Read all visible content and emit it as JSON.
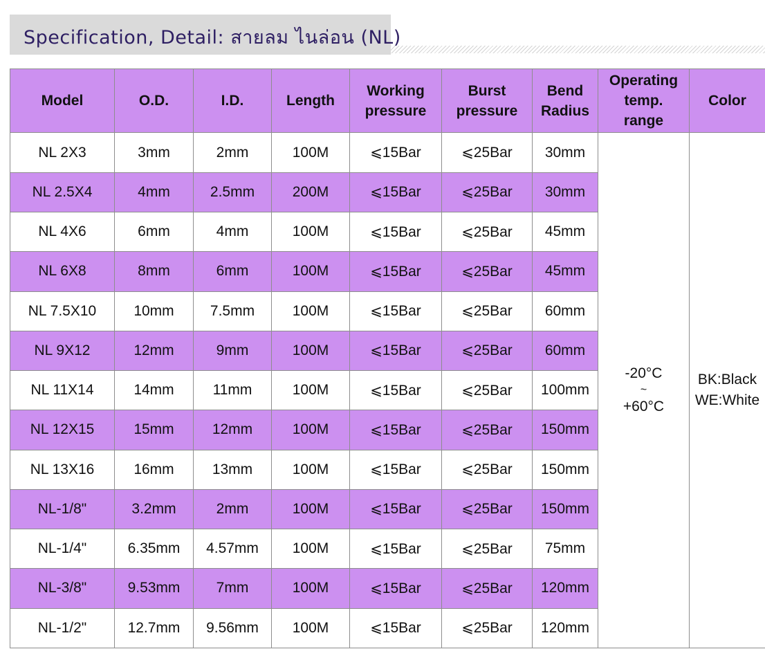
{
  "title": "Specification, Detail: สายลม ไนล่อน (NL)",
  "colors": {
    "header_bg": "#cc90f0",
    "alt_row_bg": "#cc90f0",
    "title_bar_bg": "#dadada",
    "title_text": "#2e1f63"
  },
  "table": {
    "headers": {
      "model": "Model",
      "od": "O.D.",
      "id": "I.D.",
      "length": "Length",
      "working_pressure": [
        "Working",
        "pressure"
      ],
      "burst_pressure": [
        "Burst",
        "pressure"
      ],
      "bend_radius": [
        "Bend",
        "Radius"
      ],
      "operating_temp": [
        "Operating",
        "temp.",
        "range"
      ],
      "color": "Color"
    },
    "rows": [
      [
        "NL 2X3",
        "3mm",
        "2mm",
        "100M",
        "⩽15Bar",
        "⩽25Bar",
        "30mm"
      ],
      [
        "NL 2.5X4",
        "4mm",
        "2.5mm",
        "200M",
        "⩽15Bar",
        "⩽25Bar",
        "30mm"
      ],
      [
        "NL 4X6",
        "6mm",
        "4mm",
        "100M",
        "⩽15Bar",
        "⩽25Bar",
        "45mm"
      ],
      [
        "NL 6X8",
        "8mm",
        "6mm",
        "100M",
        "⩽15Bar",
        "⩽25Bar",
        "45mm"
      ],
      [
        "NL 7.5X10",
        "10mm",
        "7.5mm",
        "100M",
        "⩽15Bar",
        "⩽25Bar",
        "60mm"
      ],
      [
        "NL 9X12",
        "12mm",
        "9mm",
        "100M",
        "⩽15Bar",
        "⩽25Bar",
        "60mm"
      ],
      [
        "NL 11X14",
        "14mm",
        "11mm",
        "100M",
        "⩽15Bar",
        "⩽25Bar",
        "100mm"
      ],
      [
        "NL 12X15",
        "15mm",
        "12mm",
        "100M",
        "⩽15Bar",
        "⩽25Bar",
        "150mm"
      ],
      [
        "NL 13X16",
        "16mm",
        "13mm",
        "100M",
        "⩽15Bar",
        "⩽25Bar",
        "150mm"
      ],
      [
        "NL-1/8\"",
        "3.2mm",
        "2mm",
        "100M",
        "⩽15Bar",
        "⩽25Bar",
        "150mm"
      ],
      [
        "NL-1/4\"",
        "6.35mm",
        "4.57mm",
        "100M",
        "⩽15Bar",
        "⩽25Bar",
        "75mm"
      ],
      [
        "NL-3/8\"",
        "9.53mm",
        "7mm",
        "100M",
        "⩽15Bar",
        "⩽25Bar",
        "120mm"
      ],
      [
        "NL-1/2\"",
        "12.7mm",
        "9.56mm",
        "100M",
        "⩽15Bar",
        "⩽25Bar",
        "120mm"
      ]
    ],
    "operating_temp_range": {
      "min": "-20°C",
      "sep": "~",
      "max": "+60°C"
    },
    "color_options": [
      "BK:Black",
      "WE:White"
    ]
  }
}
